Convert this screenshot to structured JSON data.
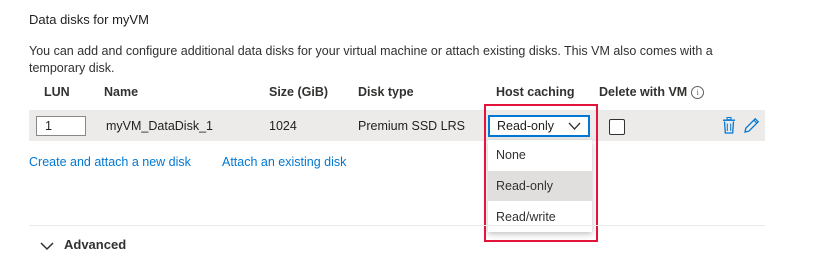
{
  "section": {
    "title": "Data disks for myVM",
    "description": "You can add and configure additional data disks for your virtual machine or attach existing disks. This VM also comes with a temporary disk."
  },
  "table": {
    "headers": {
      "lun": "LUN",
      "name": "Name",
      "size": "Size (GiB)",
      "disk_type": "Disk type",
      "host_caching": "Host caching",
      "delete_with_vm": "Delete with VM"
    },
    "rows": [
      {
        "lun": "1",
        "name": "myVM_DataDisk_1",
        "size": "1024",
        "disk_type": "Premium SSD LRS",
        "host_caching": "Read-only",
        "delete_with_vm": false
      }
    ]
  },
  "host_caching_dropdown": {
    "options": [
      "None",
      "Read-only",
      "Read/write"
    ],
    "selected": "Read-only"
  },
  "links": {
    "create_attach": "Create and attach a new disk",
    "attach_existing": "Attach an existing disk"
  },
  "advanced": {
    "label": "Advanced"
  },
  "colors": {
    "accent": "#0078d4",
    "highlight_border": "#e3143c",
    "row_background": "#edebe9"
  },
  "icons": {
    "info": "info-icon",
    "chevron": "chevron-down-icon",
    "delete": "trash-icon",
    "edit": "pencil-icon"
  }
}
